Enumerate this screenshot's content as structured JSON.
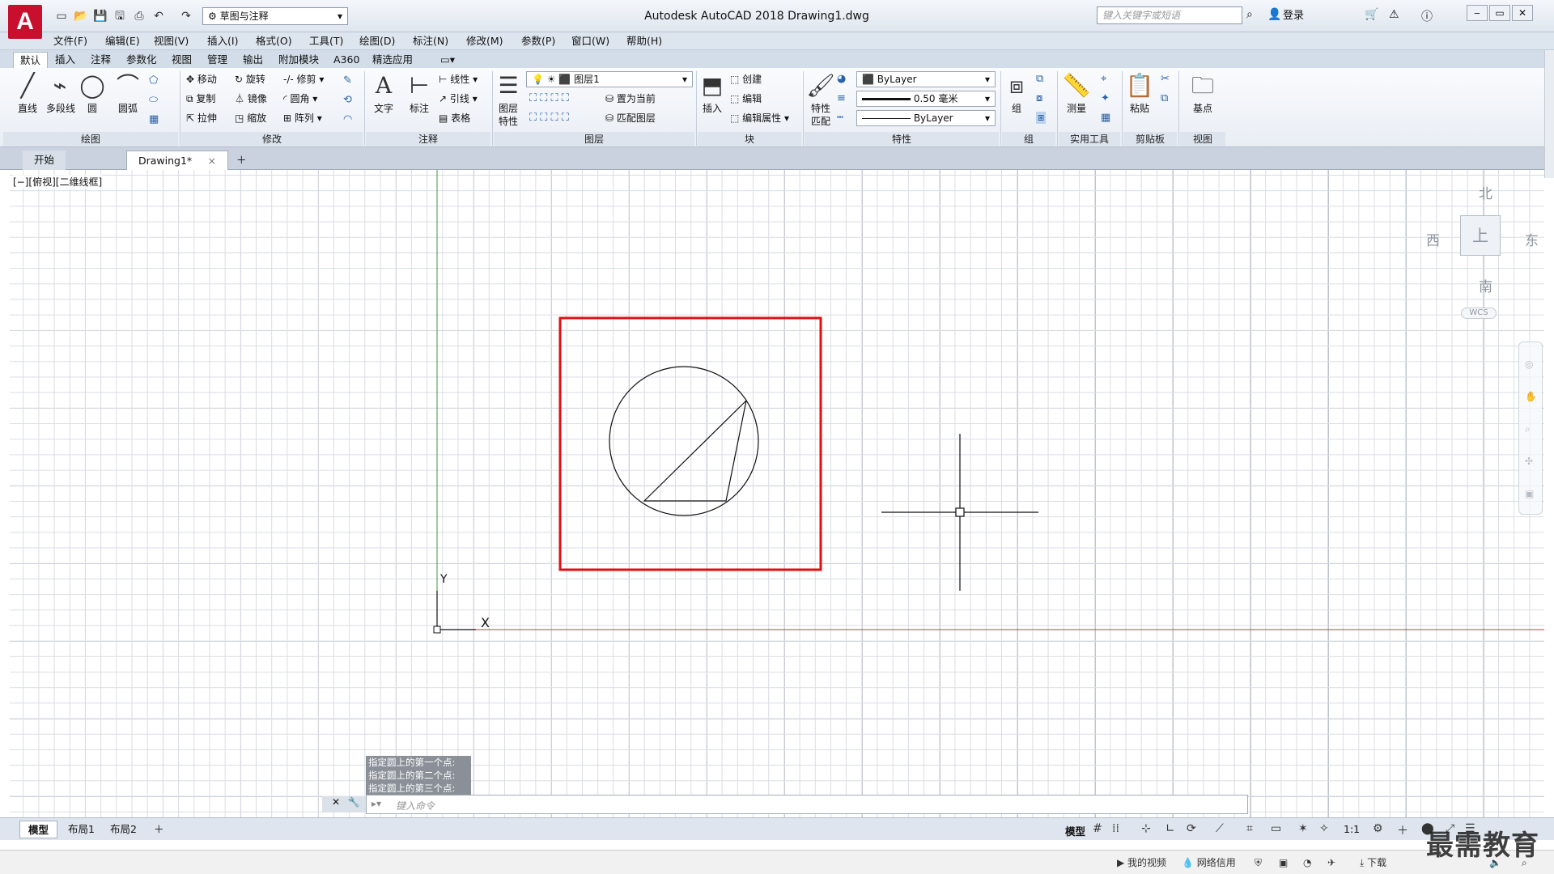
{
  "window": {
    "title": "Autodesk AutoCAD 2018    Drawing1.dwg",
    "logo": "A",
    "workspace": "草图与注释",
    "search_placeholder": "键入关键字或短语",
    "login": "登录"
  },
  "menus": [
    "文件(F)",
    "编辑(E)",
    "视图(V)",
    "插入(I)",
    "格式(O)",
    "工具(T)",
    "绘图(D)",
    "标注(N)",
    "修改(M)",
    "参数(P)",
    "窗口(W)",
    "帮助(H)"
  ],
  "ribbon_tabs": [
    "默认",
    "插入",
    "注释",
    "参数化",
    "视图",
    "管理",
    "输出",
    "附加模块",
    "A360",
    "精选应用"
  ],
  "ribbon": {
    "draw": {
      "line": "直线",
      "polyline": "多段线",
      "circle": "圆",
      "arc": "圆弧",
      "title": "绘图"
    },
    "modify": {
      "move": "移动",
      "rotate": "旋转",
      "trim": "修剪",
      "copy": "复制",
      "mirror": "镜像",
      "fillet": "圆角",
      "stretch": "拉伸",
      "scale": "缩放",
      "array": "阵列",
      "title": "修改"
    },
    "annotation": {
      "text": "文字",
      "dimension": "标注",
      "linear": "线性",
      "leader": "引线",
      "table": "表格",
      "title": "注释"
    },
    "layers": {
      "layer_properties": "图层特性",
      "current_layer": "图层1",
      "make_current": "置为当前",
      "match_layer": "匹配图层",
      "title": "图层"
    },
    "block": {
      "insert": "插入",
      "create": "创建",
      "edit": "编辑",
      "edit_attributes": "编辑属性",
      "title": "块"
    },
    "properties": {
      "match": "特性匹配",
      "color": "ByLayer",
      "lineweight": "0.50 毫米",
      "linetype": "ByLayer",
      "title": "特性"
    },
    "groups": {
      "group": "组",
      "title": "组"
    },
    "utilities": {
      "measure": "测量",
      "title": "实用工具"
    },
    "clipboard": {
      "paste": "粘贴",
      "title": "剪贴板"
    },
    "view": {
      "base": "基点",
      "title": "视图"
    }
  },
  "doc_tabs": [
    "开始",
    "Drawing1*"
  ],
  "viewport_label": "[−][俯视][二维线框]",
  "viewcube": {
    "north": "北",
    "south": "南",
    "east": "东",
    "west": "西",
    "top": "上",
    "wcs": "WCS"
  },
  "ucs": {
    "x": "X",
    "y": "Y"
  },
  "command_history": [
    "指定圆上的第一个点:",
    "指定圆上的第二个点:",
    "指定圆上的第三个点:"
  ],
  "command_placeholder": "键入命令",
  "layout_tabs": [
    "模型",
    "布局1",
    "布局2"
  ],
  "status": {
    "model": "模型",
    "scale": "1:1"
  },
  "taskbar": {
    "my_videos": "我的视频",
    "network": "网络信用",
    "download": "下载"
  },
  "watermark": "最需教育",
  "colors": {
    "highlight": "#e01010",
    "x_axis": "#c04040",
    "y_axis": "#3a9a3a",
    "brand": "#c8102e"
  }
}
